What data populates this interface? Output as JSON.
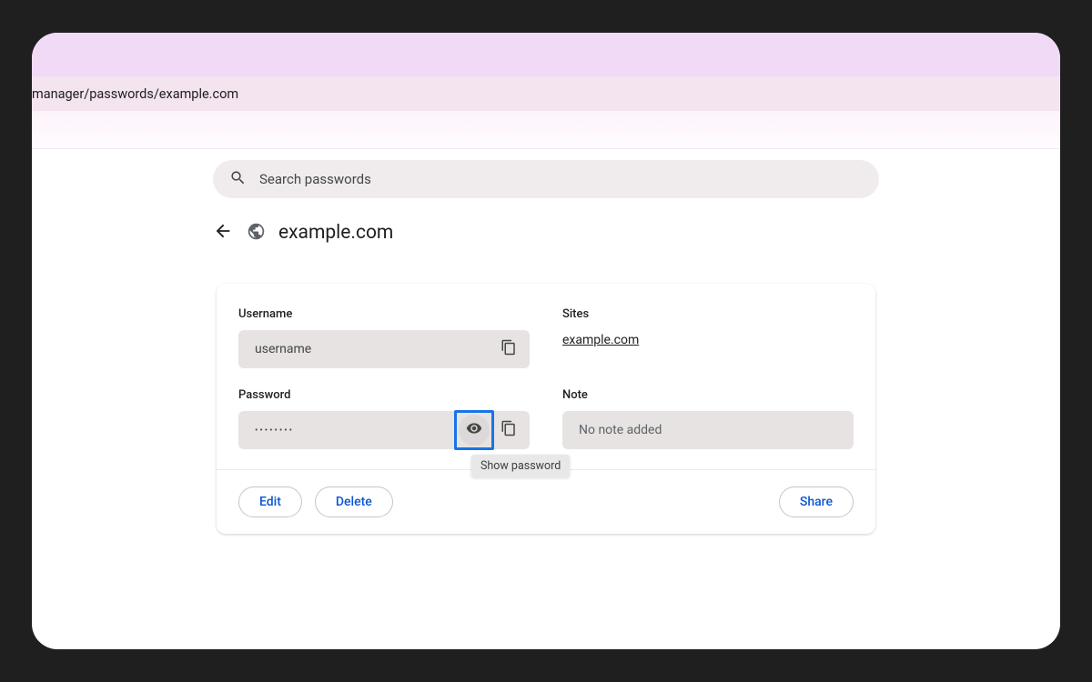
{
  "address_bar": "manager/passwords/example.com",
  "search": {
    "placeholder": "Search passwords"
  },
  "page": {
    "title": "example.com"
  },
  "fields": {
    "username": {
      "label": "Username",
      "value": "username"
    },
    "password": {
      "label": "Password",
      "value_masked": "••••••••"
    },
    "sites": {
      "label": "Sites",
      "link": "example.com"
    },
    "note": {
      "label": "Note",
      "placeholder": "No note added"
    }
  },
  "tooltip": {
    "show_password": "Show password"
  },
  "buttons": {
    "edit": "Edit",
    "delete": "Delete",
    "share": "Share"
  }
}
